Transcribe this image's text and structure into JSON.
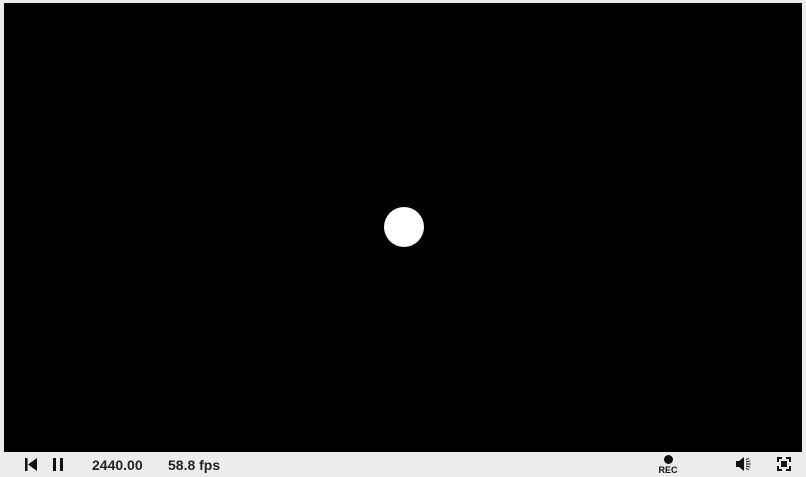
{
  "player": {
    "time": "2440.00",
    "fps": "58.8 fps",
    "rec_label": "REC"
  },
  "icons": {
    "restart": "skip-to-start-icon",
    "pause": "pause-icon",
    "record": "record-icon",
    "volume": "volume-icon",
    "fullscreen": "fullscreen-icon"
  },
  "colors": {
    "canvas": "#000000",
    "circle": "#ffffff",
    "toolbar": "#ececec",
    "text": "#222222"
  }
}
